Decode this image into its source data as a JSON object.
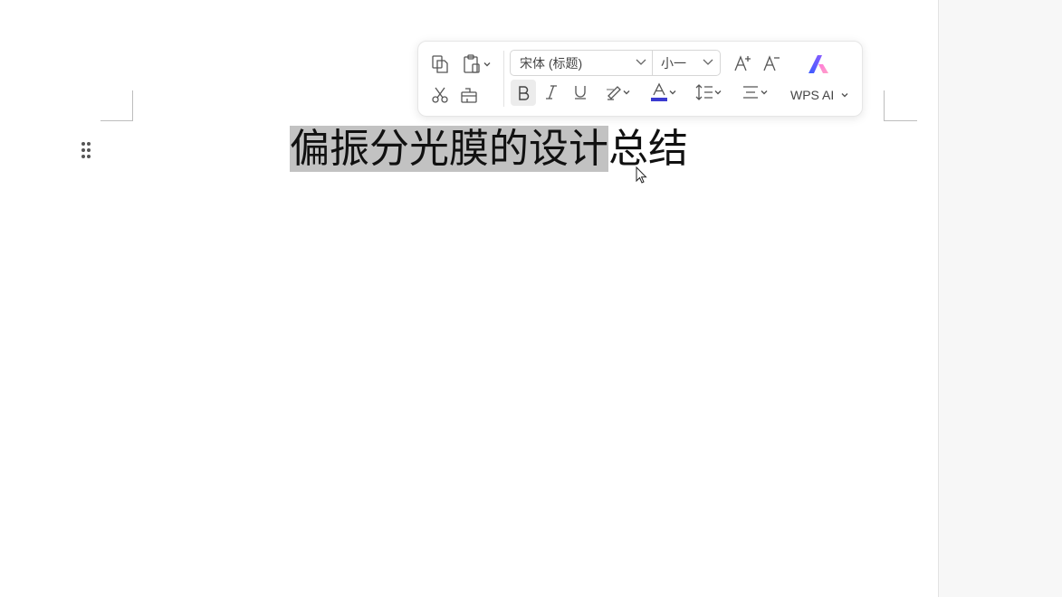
{
  "document": {
    "title_selected": "偏振分光膜的设计",
    "title_rest": "总结"
  },
  "toolbar": {
    "font_name": "宋体 (标题)",
    "font_size": "小一",
    "ai_label": "WPS AI",
    "font_color": "#3b3bd0"
  },
  "icons": [
    "copy-icon",
    "paste-icon",
    "cut-icon",
    "format-painter-icon",
    "increase-font-icon",
    "decrease-font-icon",
    "wps-ai-logo-icon",
    "bold-icon",
    "italic-icon",
    "underline-icon",
    "highlight-icon",
    "font-color-icon",
    "line-spacing-icon",
    "align-icon",
    "chevron-down-icon",
    "drag-handle-icon",
    "mouse-cursor-icon"
  ]
}
